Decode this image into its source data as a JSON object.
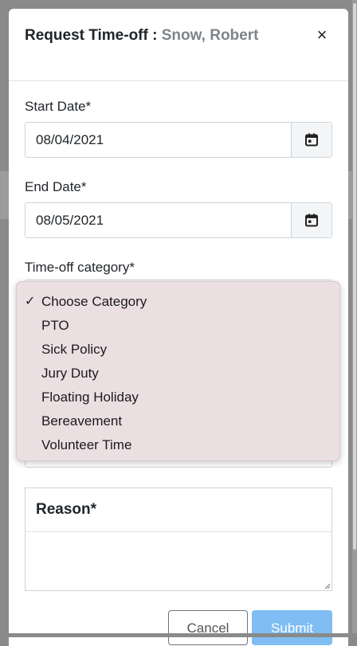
{
  "modal": {
    "title": "Request Time-off : ",
    "title_name": "Snow, Robert",
    "close_label": "×"
  },
  "form": {
    "start_date": {
      "label": "Start Date*",
      "value": "08/04/2021"
    },
    "end_date": {
      "label": "End Date*",
      "value": "08/05/2021"
    },
    "category": {
      "label": "Time-off category*",
      "selected": "Choose Category",
      "check_mark": "✓",
      "options": [
        "Choose Category",
        "PTO",
        "Sick Policy",
        "Jury Duty",
        "Floating Holiday",
        "Bereavement",
        "Volunteer Time"
      ]
    },
    "reason": {
      "label": "Reason*",
      "value": ""
    }
  },
  "buttons": {
    "cancel": "Cancel",
    "submit": "Submit"
  },
  "colors": {
    "submit_bg": "#7fbdf3",
    "dropdown_bg": "#ebdfe2",
    "subtitle": "#7e848a"
  },
  "icons": {
    "calendar": "calendar-icon",
    "close": "close-icon",
    "check": "check-icon"
  }
}
